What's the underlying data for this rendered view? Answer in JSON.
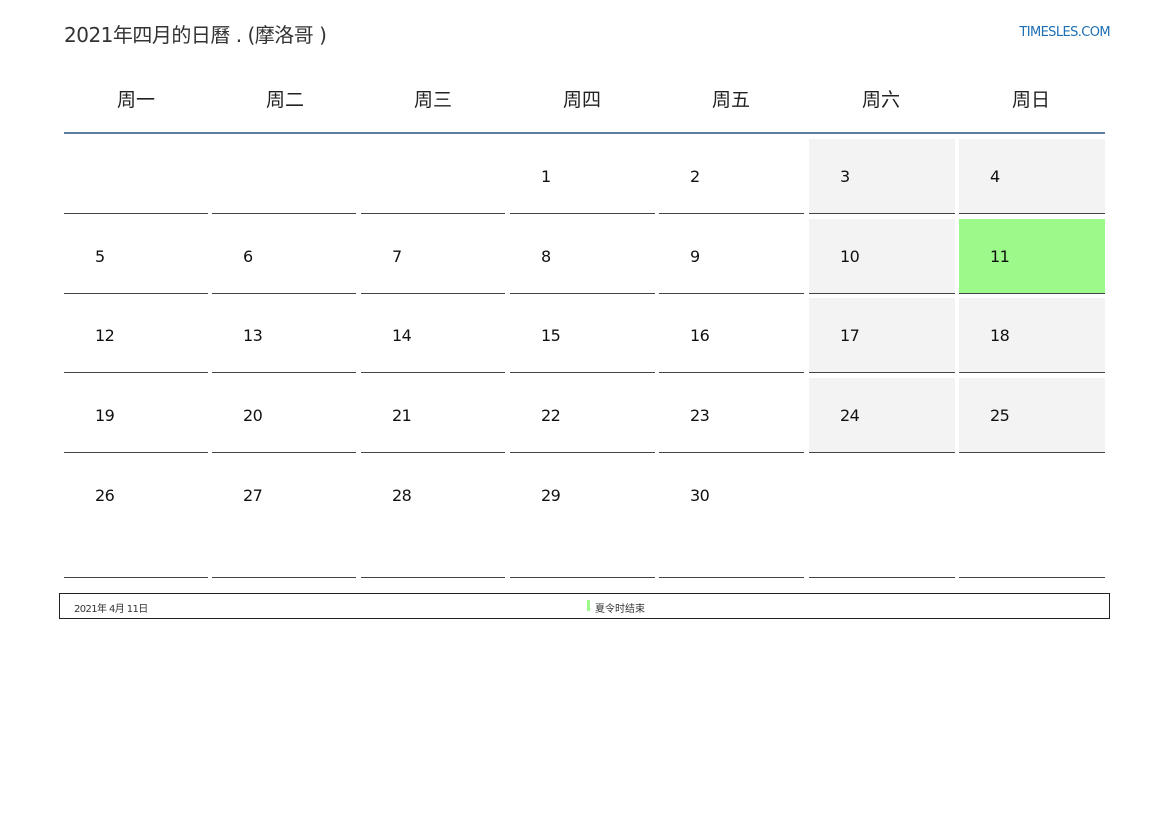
{
  "header": {
    "title": "2021年四月的日曆 . (摩洛哥 )",
    "site": "TIMESLES.COM"
  },
  "weekdays": [
    "周一",
    "周二",
    "周三",
    "周四",
    "周五",
    "周六",
    "周日"
  ],
  "weeks": [
    [
      "",
      "",
      "",
      "1",
      "2",
      "3",
      "4"
    ],
    [
      "5",
      "6",
      "7",
      "8",
      "9",
      "10",
      "11"
    ],
    [
      "12",
      "13",
      "14",
      "15",
      "16",
      "17",
      "18"
    ],
    [
      "19",
      "20",
      "21",
      "22",
      "23",
      "24",
      "25"
    ],
    [
      "26",
      "27",
      "28",
      "29",
      "30",
      "",
      ""
    ]
  ],
  "highlight": {
    "day": "11",
    "color": "#9dfa8a"
  },
  "colors": {
    "weekend_bg": "#f3f3f3",
    "header_rule": "#5f7d9e",
    "link": "#1f6fb4"
  },
  "legend": {
    "date": "2021年 4月 11日",
    "event": "夏令时结束"
  }
}
